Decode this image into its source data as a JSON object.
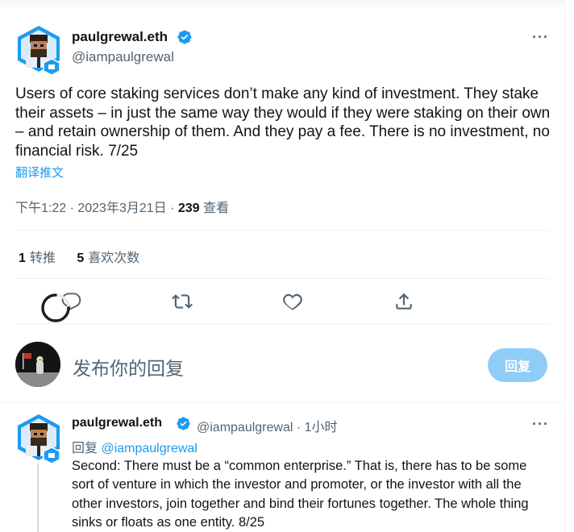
{
  "tweet": {
    "display_name": "paulgrewal.eth",
    "handle": "@iampaulgrewal",
    "text": "Users of core staking services don’t make any kind of investment. They stake their assets – in just the same way they would if they were staking on their own – and retain ownership of them. And they pay a fee. There is no investment, no financial risk. 7/25",
    "translate_label": "翻译推文",
    "time": "下午1:22 · 2023年3月21日 · ",
    "views_count": "239",
    "views_label": " 查看",
    "retweets_count": "1",
    "retweets_label": "转推",
    "likes_count": "5",
    "likes_label": "喜欢次数",
    "more_icon": "more-icon"
  },
  "compose": {
    "placeholder": "发布你的回复",
    "button_label": "回复"
  },
  "reply": {
    "display_name": "paulgrewal.eth",
    "handle_time": "@iampaulgrewal · 1小时",
    "replying_prefix": "回复 ",
    "replying_handle": "@iampaulgrewal",
    "text": "Second: There must be a “common enterprise.” That is, there has to be some sort of venture in which the investor and promoter, or the investor with all the other investors, join together and bind their fortunes together. The whole thing sinks or floats as one entity. 8/25"
  },
  "colors": {
    "accent": "#1d9bf0",
    "reply_button_disabled": "#8ecdf8",
    "secondary_text": "#536471",
    "primary_text": "#0f1419"
  }
}
